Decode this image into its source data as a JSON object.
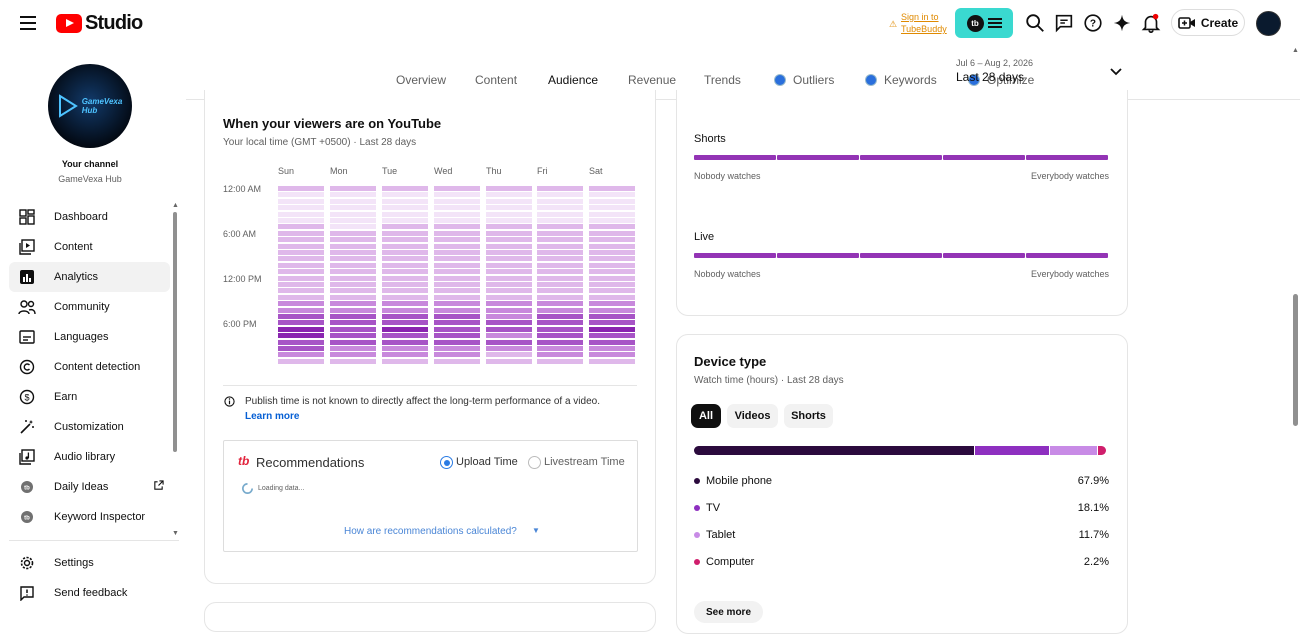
{
  "topbar": {
    "app_title": "Studio",
    "tubebuddy_sign_in_line1": "Sign in to",
    "tubebuddy_sign_in_line2": "TubeBuddy",
    "tubebuddy_badge": "tb",
    "create_label": "Create"
  },
  "sidebar": {
    "avatar_text_line1": "GameVexa",
    "avatar_text_line2": "Hub",
    "your_channel_label": "Your channel",
    "channel_name": "GameVexa Hub",
    "items": [
      {
        "label": "Dashboard",
        "icon": "dashboard-icon"
      },
      {
        "label": "Content",
        "icon": "content-icon"
      },
      {
        "label": "Analytics",
        "icon": "analytics-icon",
        "active": true
      },
      {
        "label": "Community",
        "icon": "community-icon"
      },
      {
        "label": "Languages",
        "icon": "languages-icon"
      },
      {
        "label": "Content detection",
        "icon": "copyright-icon"
      },
      {
        "label": "Earn",
        "icon": "dollar-icon"
      },
      {
        "label": "Customization",
        "icon": "magic-wand-icon"
      },
      {
        "label": "Audio library",
        "icon": "audio-library-icon"
      },
      {
        "label": "Daily Ideas",
        "icon": "tubebuddy-icon"
      },
      {
        "label": "Keyword Inspector",
        "icon": "tubebuddy-icon"
      }
    ],
    "bottom_items": [
      {
        "label": "Settings",
        "icon": "gear-icon"
      },
      {
        "label": "Send feedback",
        "icon": "feedback-icon"
      }
    ]
  },
  "tabs": [
    {
      "label": "Overview"
    },
    {
      "label": "Content"
    },
    {
      "label": "Audience",
      "active": true
    },
    {
      "label": "Revenue"
    },
    {
      "label": "Trends"
    },
    {
      "label": "Outliers",
      "tubebuddy": true
    },
    {
      "label": "Keywords",
      "tubebuddy": true
    },
    {
      "label": "Optimize",
      "tubebuddy": true
    }
  ],
  "date_range": {
    "dates": "Jul 6 – Aug 2, 2026",
    "label": "Last 28 days"
  },
  "viewers_card": {
    "title": "When your viewers are on YouTube",
    "subtitle": "Your local time (GMT +0500) · Last 28 days",
    "days": [
      "Sun",
      "Mon",
      "Tue",
      "Wed",
      "Thu",
      "Fri",
      "Sat"
    ],
    "time_labels": [
      "12:00 AM",
      "6:00 AM",
      "12:00 PM",
      "6:00 PM"
    ],
    "heatmap_levels": [
      [
        2,
        1,
        1,
        1,
        1,
        1,
        2,
        2,
        2,
        2,
        2,
        2,
        2,
        2,
        2,
        2,
        2,
        2,
        3,
        3,
        4,
        4,
        5,
        5,
        4,
        4,
        3,
        2
      ],
      [
        2,
        1,
        1,
        1,
        1,
        1,
        1,
        2,
        2,
        2,
        2,
        2,
        2,
        2,
        2,
        2,
        2,
        2,
        3,
        3,
        4,
        4,
        4,
        4,
        4,
        3,
        3,
        2
      ],
      [
        2,
        1,
        1,
        1,
        1,
        1,
        2,
        2,
        2,
        2,
        2,
        2,
        2,
        2,
        2,
        2,
        2,
        2,
        3,
        3,
        4,
        4,
        5,
        4,
        4,
        3,
        3,
        2
      ],
      [
        2,
        1,
        1,
        1,
        1,
        1,
        2,
        2,
        2,
        2,
        2,
        2,
        2,
        2,
        2,
        2,
        2,
        2,
        3,
        3,
        4,
        4,
        4,
        4,
        4,
        3,
        3,
        2
      ],
      [
        2,
        1,
        1,
        1,
        1,
        1,
        2,
        2,
        2,
        2,
        2,
        2,
        2,
        2,
        2,
        2,
        2,
        2,
        3,
        3,
        3,
        4,
        4,
        3,
        4,
        3,
        2,
        2
      ],
      [
        2,
        1,
        1,
        1,
        1,
        1,
        2,
        2,
        2,
        2,
        2,
        2,
        2,
        2,
        2,
        2,
        2,
        2,
        3,
        3,
        4,
        4,
        4,
        4,
        4,
        3,
        3,
        2
      ],
      [
        2,
        1,
        1,
        1,
        1,
        1,
        2,
        2,
        2,
        2,
        2,
        2,
        2,
        2,
        2,
        2,
        2,
        2,
        3,
        3,
        4,
        4,
        5,
        4,
        4,
        3,
        3,
        2
      ]
    ],
    "info_text": "Publish time is not known to directly affect the long-term performance of a video.",
    "learn_more": "Learn more",
    "recommendations": {
      "title": "Recommendations",
      "upload_time": "Upload Time",
      "livestream_time": "Livestream Time",
      "loading": "Loading data...",
      "how_link": "How are recommendations calculated?"
    }
  },
  "watch_card": {
    "rows": [
      {
        "label": "Shorts",
        "left": "Nobody watches",
        "right": "Everybody watches"
      },
      {
        "label": "Live",
        "left": "Nobody watches",
        "right": "Everybody watches"
      }
    ]
  },
  "device_card": {
    "title": "Device type",
    "subtitle": "Watch time (hours) · Last 28 days",
    "chips": [
      "All",
      "Videos",
      "Shorts"
    ],
    "segments": [
      {
        "label": "Mobile phone",
        "value": "67.9%",
        "pct": 67.9,
        "color": "#2b0a3d"
      },
      {
        "label": "TV",
        "value": "18.1%",
        "pct": 18.1,
        "color": "#8e2fc0"
      },
      {
        "label": "Tablet",
        "value": "11.7%",
        "pct": 11.7,
        "color": "#c88be6"
      },
      {
        "label": "Computer",
        "value": "2.2%",
        "pct": 2.2,
        "color": "#d01e6c"
      }
    ],
    "see_more": "See more"
  },
  "colors": {
    "heat_1": "#f3e4f8",
    "heat_2": "#dfb8ea",
    "heat_3": "#c889dc",
    "heat_4": "#a754c6",
    "heat_5": "#8a25b0",
    "accent_blue": "#065fd4"
  }
}
